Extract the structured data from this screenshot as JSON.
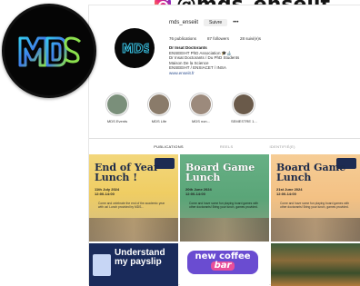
{
  "header": {
    "title": "@mds_enseiit",
    "app": "instagram"
  },
  "profile": {
    "handle": "mds_enseiit",
    "follow_label": "Suivre",
    "more_label": "•••",
    "stats": [
      "76 publications",
      "87 followers",
      "28 suivi(e)s"
    ],
    "bio_name": "Dr Insat Doctorants",
    "bio_lines": [
      "ENSEEIHT PhD Association 🎓🔬",
      "Dr Insat Doctorants / Du PhD Students",
      "Maison De la Science",
      "ENSEEIHT / ENSIACET / INSA"
    ],
    "bio_link": "www.enseiit.fr"
  },
  "highlights": [
    {
      "label": "MDS Events",
      "color": "#7a8f7a"
    },
    {
      "label": "MDS Life",
      "color": "#8a7b6a"
    },
    {
      "label": "MDS non...",
      "color": "#9c8a7c"
    },
    {
      "label": "SEMESTRE 1...",
      "color": "#6a5a4a"
    }
  ],
  "tabs": [
    "PUBLICATIONS",
    "REELS",
    "IDENTIFIÉ(E)"
  ],
  "posts": [
    {
      "title": "End of Year Lunch !",
      "date": "11th July 2024",
      "time": "12:00-14:00",
      "body": "Come and celebrate the end of the academic year with us! Lunch provided by MDS..."
    },
    {
      "title": "Board Game Lunch",
      "date": "20th June 2024",
      "time": "12:00-14:00",
      "body": "Come and have some fun playing board games with other doctorants! Bring your lunch, games provided."
    },
    {
      "title": "Board Game Lunch",
      "date": "21st June 2024",
      "time": "12:00-14:00",
      "body": "Come and have some fun playing board games with other doctorants! Bring your lunch, games provided."
    },
    {
      "title": "Understand my payslip"
    },
    {
      "title": "new coffee",
      "subtitle": "bar"
    },
    {
      "title": ""
    }
  ]
}
